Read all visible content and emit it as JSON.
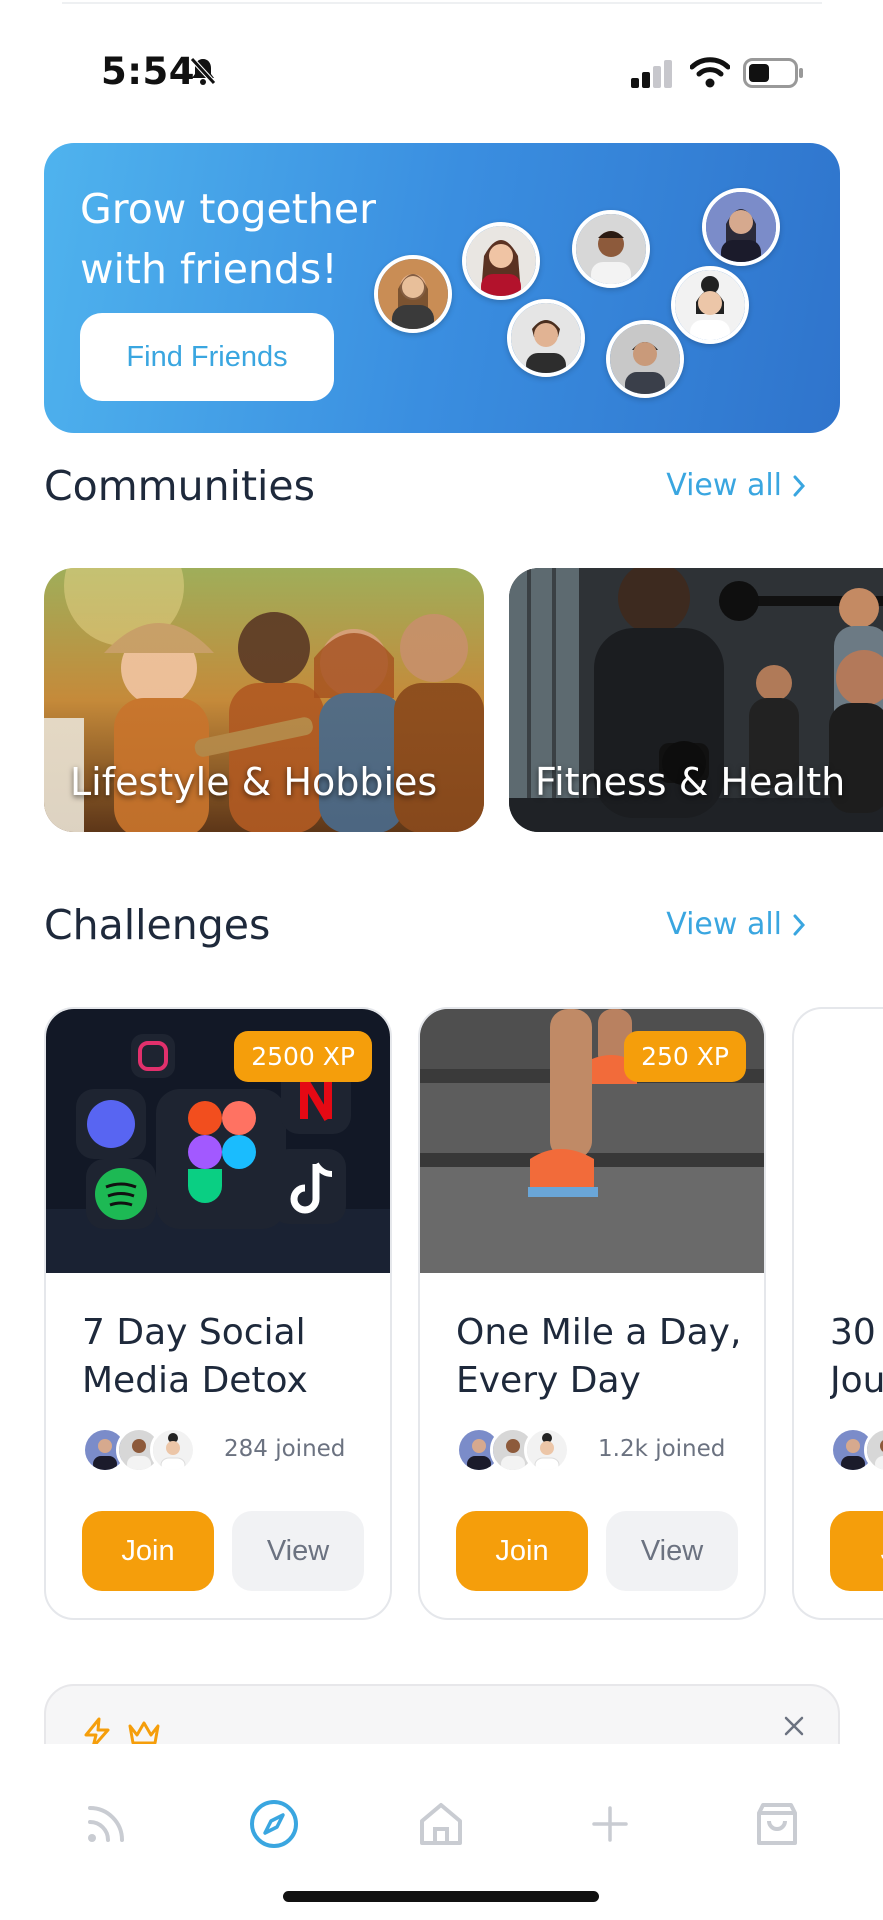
{
  "status_bar": {
    "time": "5:54",
    "icons": [
      "bell-slash-icon",
      "signal-icon",
      "wifi-icon",
      "battery-icon"
    ]
  },
  "hero": {
    "title": "Grow together with friends!",
    "button_label": "Find Friends",
    "gradient": [
      "#4fb3ee",
      "#2f74cc"
    ]
  },
  "communities": {
    "heading": "Communities",
    "view_all": "View all",
    "items": [
      {
        "label": "Lifestyle & Hobbies"
      },
      {
        "label": "Fitness & Health"
      }
    ]
  },
  "challenges": {
    "heading": "Challenges",
    "view_all": "View all",
    "items": [
      {
        "title": "7 Day Social Media Detox",
        "xp": "2500 XP",
        "joined": "284 joined",
        "join_label": "Join",
        "view_label": "View"
      },
      {
        "title": "One Mile a Day, Every Day",
        "xp": "250 XP",
        "joined": "1.2k joined",
        "join_label": "Join",
        "view_label": "View"
      },
      {
        "title": "30 Jou",
        "join_label": "Jo"
      }
    ]
  },
  "bottom_nav": {
    "items": [
      "feed-icon",
      "explore-icon",
      "home-icon",
      "add-icon",
      "shop-icon"
    ],
    "active": "explore-icon"
  },
  "colors": {
    "accent_blue": "#3aa6e0",
    "accent_orange": "#f59e0b"
  }
}
